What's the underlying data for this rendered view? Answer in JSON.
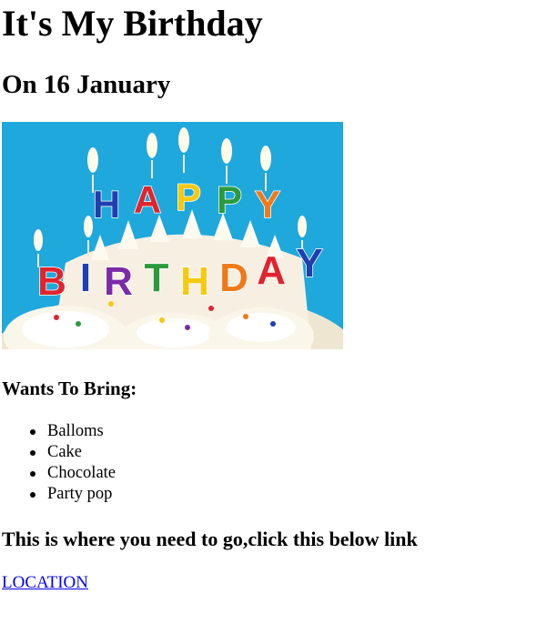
{
  "page": {
    "title": "It's My Birthday",
    "subtitle": "On 16 January"
  },
  "image": {
    "letters_top": [
      "H",
      "A",
      "P",
      "P",
      "Y"
    ],
    "letters_bottom": [
      "B",
      "I",
      "R",
      "T",
      "H",
      "D",
      "A",
      "Y"
    ],
    "colors": {
      "background": "#1fa8dc",
      "cake": "#f7f0e2",
      "letter_blue": "#1f3fb0",
      "letter_red": "#e0242e",
      "letter_yellow": "#f6c90e",
      "letter_green": "#2c9a3c",
      "letter_orange": "#f07a1a",
      "letter_purple": "#7b2aa8",
      "flame": "#fffbe8"
    }
  },
  "bring": {
    "heading": "Wants To Bring:",
    "items": [
      "Balloms",
      "Cake",
      "Chocolate",
      "Party pop"
    ]
  },
  "directions": {
    "heading": "This is where you need to go,click this below link",
    "link_label": "LOCATION"
  },
  "colors": {
    "link": "#0000ee",
    "text": "#000000"
  }
}
